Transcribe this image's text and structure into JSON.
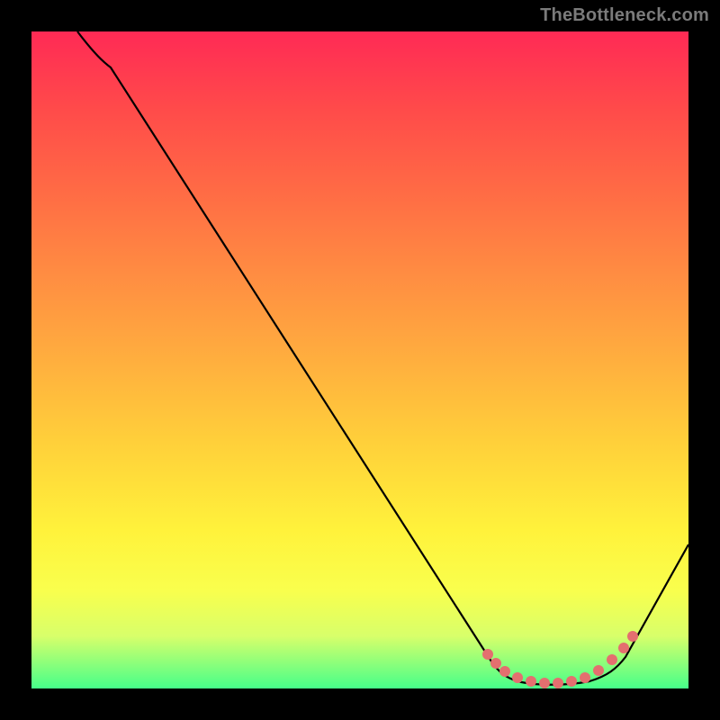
{
  "watermark": {
    "text": "TheBottleneck.com"
  },
  "chart_data": {
    "type": "line",
    "title": "",
    "xlabel": "",
    "ylabel": "",
    "xlim": [
      0,
      100
    ],
    "ylim": [
      0,
      100
    ],
    "series": [
      {
        "name": "curve",
        "x": [
          7,
          12,
          70,
          72,
          75,
          78,
          81,
          84,
          87,
          90,
          100
        ],
        "y": [
          100,
          95,
          4,
          2,
          1,
          0.5,
          0.5,
          1,
          2,
          5,
          22
        ]
      }
    ],
    "optimal_region": {
      "name": "optimal-dots",
      "x": [
        69.5,
        72,
        74,
        76,
        78,
        80,
        82,
        84,
        86,
        88,
        90,
        91.5
      ],
      "y": [
        5.2,
        2.6,
        1.8,
        1.2,
        0.9,
        0.8,
        0.9,
        1.2,
        1.9,
        3.0,
        4.8,
        6.8
      ]
    },
    "colors": {
      "curve": "#000000",
      "dots": "#e46f6f",
      "bg_top": "#ff2a55",
      "bg_bottom": "#46ff8a"
    }
  }
}
